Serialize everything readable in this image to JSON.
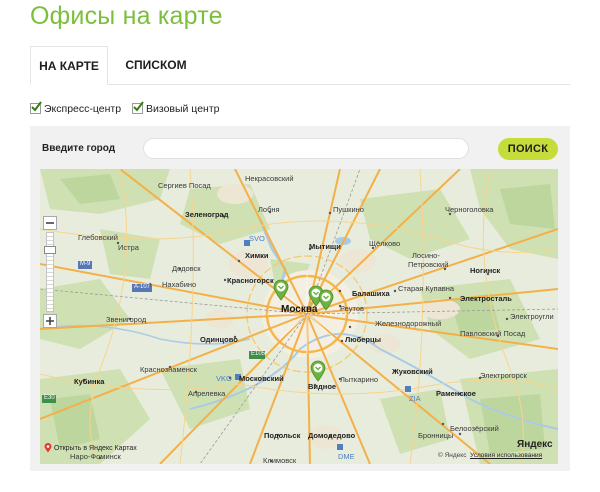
{
  "page": {
    "title": "Офисы на карте"
  },
  "tabs": [
    {
      "label": "НА КАРТЕ",
      "active": true
    },
    {
      "label": "СПИСКОМ",
      "active": false
    }
  ],
  "filters": [
    {
      "label": "Экспресс-центр",
      "checked": true
    },
    {
      "label": "Визовый центр",
      "checked": true
    }
  ],
  "search": {
    "label": "Введите город",
    "value": "",
    "placeholder": "",
    "button_label": "ПОИСК"
  },
  "colors": {
    "accent": "#7bbf3c",
    "button": "#c6dc3a",
    "marker": "#6db33f"
  },
  "map": {
    "places": {
      "sergiev_posad_area": "Сергиев Посад",
      "nekrasovsky": "Некрасовский",
      "zelenograd": "Зеленоград",
      "lobnya": "Лобня",
      "pushkino": "Пушкино",
      "chernogolovka": "Черноголовка",
      "glebovsky": "Глебовский",
      "sheremetyevo": "SVO",
      "istra": "Истра",
      "khimki": "Химки",
      "mytishchi": "Мытищи",
      "shchyolkovo": "Щёлково",
      "losino": "Лосино-",
      "petrovsky": "Петровский",
      "dedovsk": "Дедовск",
      "noginsk": "Ногинск",
      "m9": "M-9",
      "nakhabino": "Нахабино",
      "krasnogorsk": "Красногорск",
      "balashikha": "Балашиха",
      "staraya_kupavna": "Старая Купавна",
      "a107": "A-107",
      "elektrostal": "Электросталь",
      "zvenigorod": "Звенигород",
      "moskva": "Москва",
      "reutov": "Реутов",
      "elektrougli": "Электроугли",
      "zheleznodorozhny": "Железнодорожный",
      "odintsovo": "Одинцово",
      "lyubertsy": "Люберцы",
      "pavlovsky_posad": "Павловский Посад",
      "e105": "E105",
      "krasnoznamensk": "Краснознаменск",
      "zhukovsky": "Жуковский",
      "kubinka": "Кубинка",
      "vko": "VKO",
      "moskovsky": "Московский",
      "vidnoe": "Видное",
      "lytkarino": "Лыткарино",
      "elektrogorsk": "Электрогорск",
      "aprelevka": "Апрелевка",
      "ramenskoe": "Раменское",
      "e30": "E30",
      "zia": "ZIA",
      "podolsk": "Подольск",
      "domodedovo": "Домодедово",
      "bronnitsy": "Бронницы",
      "belooziorsky": "Белоозёрский",
      "klimovsk": "Климовск",
      "dme": "DME",
      "naro_fominsk": "Наро-Фоминск"
    },
    "open_in_yandex": "Открыть в Яндекс Картах",
    "yandex_logo": "Яндекс",
    "copyright": "© Яндекс",
    "terms": "Условия использования"
  }
}
